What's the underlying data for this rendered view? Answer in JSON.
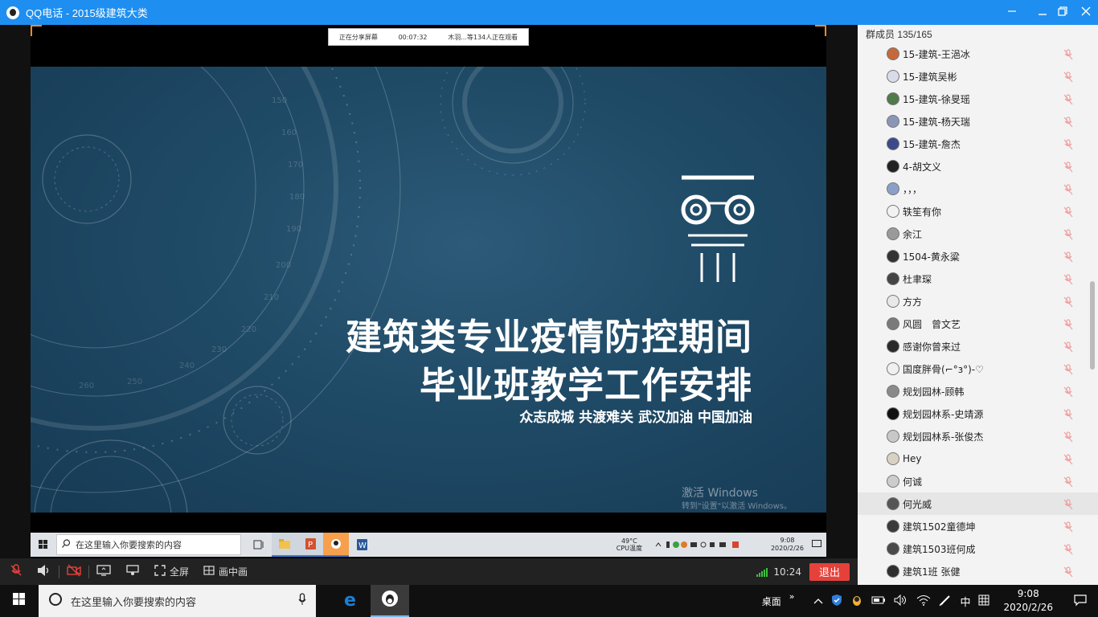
{
  "window": {
    "title": "QQ电话 - 2015级建筑大类",
    "min_icon": "minimize-icon",
    "max_icon": "restore-icon",
    "close_icon": "close-icon",
    "pin_icon": "pin-icon"
  },
  "share_banner": {
    "status": "正在分享屏幕",
    "duration": "00:07:32",
    "viewers": "木羽...等134人正在观看"
  },
  "slide": {
    "title_line1": "建筑类专业疫情防控期间",
    "title_line2": "毕业班教学工作安排",
    "slogan": "众志成城 共渡难关 武汉加油 中国加油",
    "watermark_title": "激活 Windows",
    "watermark_sub": "转到\"设置\"以激活 Windows。",
    "dial_numbers": [
      "150",
      "160",
      "170",
      "180",
      "190",
      "200",
      "210",
      "220",
      "230",
      "240",
      "250",
      "260"
    ]
  },
  "inner_taskbar": {
    "search_placeholder": "在这里输入你要搜索的内容",
    "cpu_temp": "49°C",
    "cpu_label": "CPU温度",
    "time": "9:08",
    "date": "2020/2/26"
  },
  "members": {
    "header": "群成员 135/165",
    "list": [
      {
        "name": "15-建筑-王浥冰",
        "color": "#c46a3a"
      },
      {
        "name": "15-建筑吴彬",
        "color": "#d8dbe8"
      },
      {
        "name": "15-建筑-徐旻瑶",
        "color": "#4f7a4a"
      },
      {
        "name": "15-建筑-杨天瑞",
        "color": "#8a96b8"
      },
      {
        "name": "15-建筑-詹杰",
        "color": "#3c4a8a"
      },
      {
        "name": "4-胡文义",
        "color": "#222222"
      },
      {
        "name": "，，，",
        "color": "#8aa0c8"
      },
      {
        "name": "轶笙有你",
        "color": "#f2f2f2"
      },
      {
        "name": "余江",
        "color": "#9a9a9a"
      },
      {
        "name": "1504-黄永粱",
        "color": "#333333"
      },
      {
        "name": "杜聿琛",
        "color": "#444444"
      },
      {
        "name": "方方",
        "color": "#e8e8e8"
      },
      {
        "name": "风圆　曾文艺",
        "color": "#7a7a7a"
      },
      {
        "name": "感谢你曾来过",
        "color": "#2a2a2a"
      },
      {
        "name": "国度胖骨(⌐°з°)-♡",
        "color": "#f0f0f0"
      },
      {
        "name": "规划园林-顾韩",
        "color": "#8a8a8a"
      },
      {
        "name": "规划园林系-史靖源",
        "color": "#111111"
      },
      {
        "name": "规划园林系-张俊杰",
        "color": "#c8c8c8"
      },
      {
        "name": "Hey",
        "color": "#d9d2c2"
      },
      {
        "name": "何诚",
        "color": "#cccccc"
      },
      {
        "name": "何光威",
        "color": "#555555"
      },
      {
        "name": "建筑1502童德坤",
        "color": "#3a3a3a"
      },
      {
        "name": "建筑1503班何成",
        "color": "#4a4a4a"
      },
      {
        "name": "建筑1班  张健",
        "color": "#2e2e2e"
      }
    ],
    "highlighted_index": 20
  },
  "controls": {
    "mic_icon": "mic-muted-icon",
    "speaker_icon": "speaker-icon",
    "camera_icon": "camera-off-icon",
    "share_icon": "screen-share-icon",
    "present_icon": "present-icon",
    "fullscreen_label": "全屏",
    "pip_label": "画中画",
    "time": "10:24",
    "exit_label": "退出"
  },
  "taskbar": {
    "search_placeholder": "在这里输入你要搜索的内容",
    "desktop_label": "桌面",
    "ime": "中",
    "time": "9:08",
    "date": "2020/2/26"
  }
}
